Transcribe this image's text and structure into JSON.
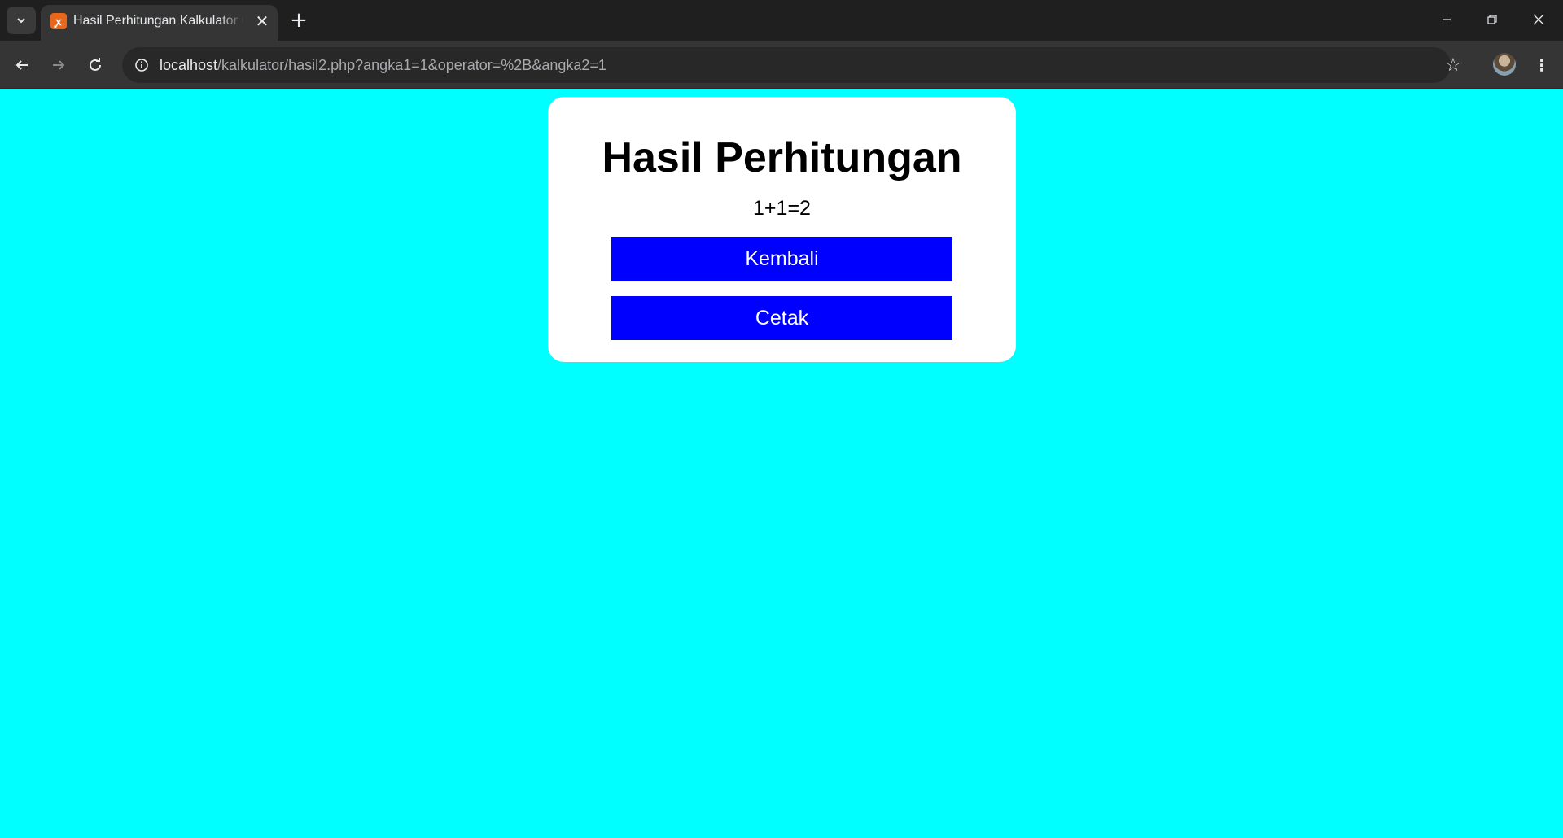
{
  "browser": {
    "tab": {
      "title": "Hasil Perhitungan Kalkulator Online",
      "favicon": "xampp-icon",
      "close": "✕"
    },
    "new_tab": "+",
    "window_controls": {
      "minimize": "—",
      "maximize": "❐",
      "close": "✕"
    },
    "nav": {
      "back": "←",
      "forward": "→",
      "reload": "↻"
    },
    "url": {
      "host": "localhost",
      "path": "/kalkulator/hasil2.php?angka1=1&operator=%2B&angka2=1"
    },
    "bookmark_star": "☆",
    "menu": "⋮"
  },
  "page": {
    "background": "#00ffff",
    "title": "Hasil Perhitungan",
    "result": "1+1=2",
    "buttons": {
      "back": "Kembali",
      "print": "Cetak"
    },
    "button_color": "#0000ff"
  }
}
